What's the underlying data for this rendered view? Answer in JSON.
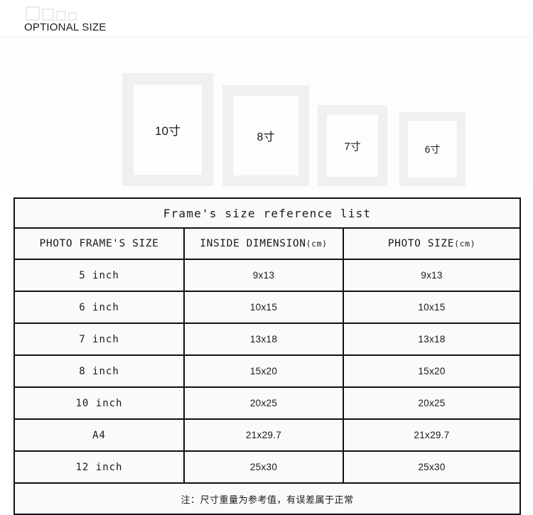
{
  "banner": {
    "title": "OPTIONAL SIZE",
    "decorative_squares": 4
  },
  "frames": [
    {
      "name": "frame-10-inch",
      "label": "10寸"
    },
    {
      "name": "frame-8-inch",
      "label": "8寸"
    },
    {
      "name": "frame-7-inch",
      "label": "7寸"
    },
    {
      "name": "frame-6-inch",
      "label": "6寸"
    }
  ],
  "table": {
    "title": "Frame's size reference list",
    "columns": [
      {
        "label": "PHOTO FRAME'S SIZE",
        "unit": ""
      },
      {
        "label": "INSIDE DIMENSION",
        "unit": "(cm)"
      },
      {
        "label": "PHOTO SIZE",
        "unit": "(cm)"
      }
    ],
    "rows": [
      {
        "size": "5 inch",
        "inside": "9x13",
        "photo": "9x13"
      },
      {
        "size": "6 inch",
        "inside": "10x15",
        "photo": "10x15"
      },
      {
        "size": "7 inch",
        "inside": "13x18",
        "photo": "13x18"
      },
      {
        "size": "8 inch",
        "inside": "15x20",
        "photo": "15x20"
      },
      {
        "size": "10 inch",
        "inside": "20x25",
        "photo": "20x25"
      },
      {
        "size": "A4",
        "inside": "21x29.7",
        "photo": "21x29.7"
      },
      {
        "size": "12 inch",
        "inside": "25x30",
        "photo": "25x30"
      }
    ],
    "note": "注：尺寸重量为参考值，有误差属于正常"
  },
  "colors": {
    "title_row_bg": "#e3e2e5",
    "cell_bg": "#faf9fb",
    "border": "#111111",
    "frame_mat": "#eef0f2",
    "deco_square_border": "#eceaef"
  }
}
